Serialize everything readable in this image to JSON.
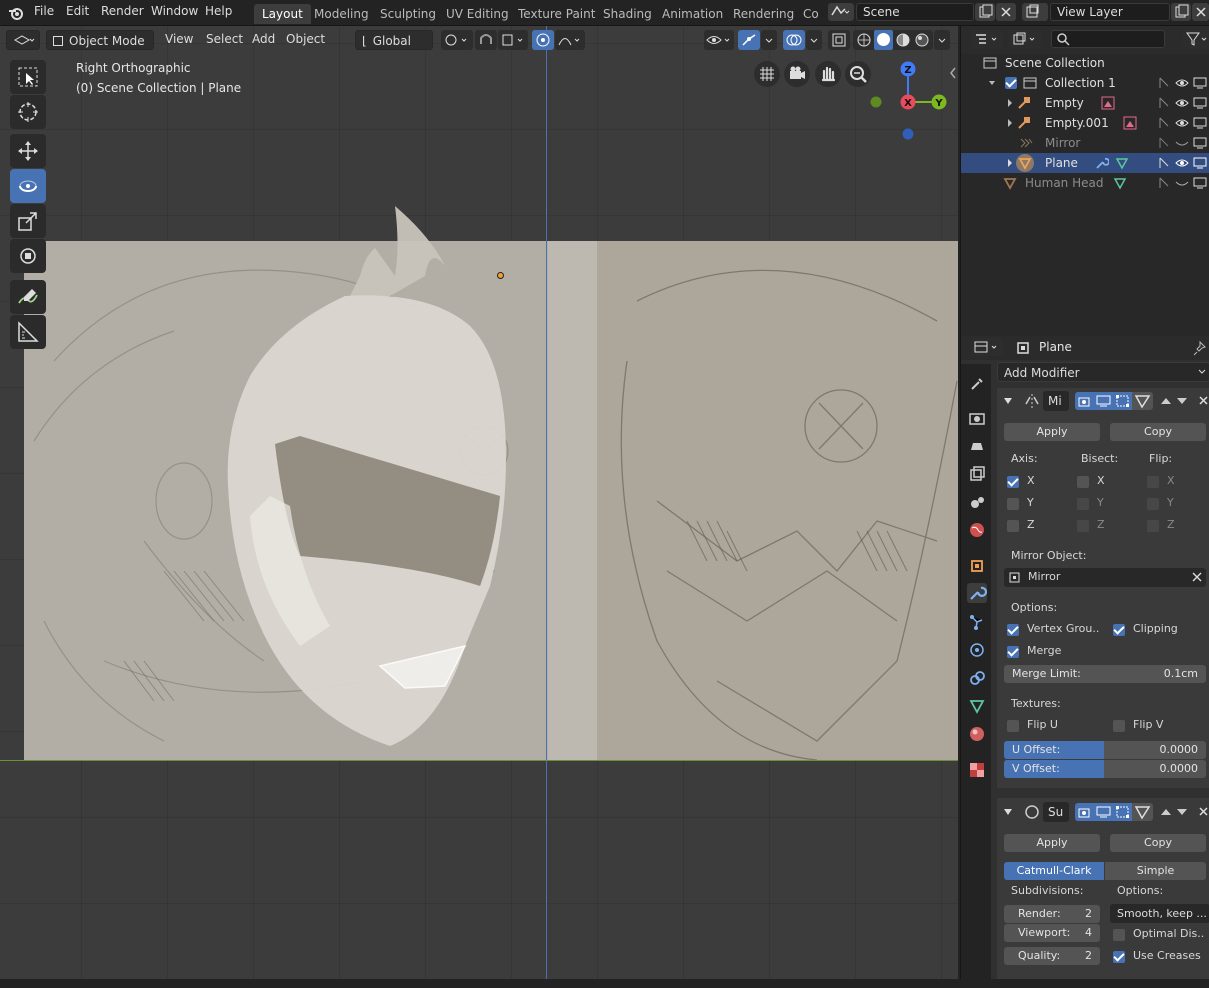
{
  "menu": {
    "items": [
      "File",
      "Edit",
      "Render",
      "Window",
      "Help"
    ]
  },
  "workspaces": {
    "tabs": [
      "Layout",
      "Modeling",
      "Sculpting",
      "UV Editing",
      "Texture Paint",
      "Shading",
      "Animation",
      "Rendering",
      "Co"
    ],
    "active": "Layout"
  },
  "scene": {
    "name": "Scene"
  },
  "view_layer": {
    "name": "View Layer"
  },
  "viewport": {
    "mode": "Object Mode",
    "menus": [
      "View",
      "Select",
      "Add",
      "Object"
    ],
    "transform_orientation": "Global",
    "view_name": "Right Orthographic",
    "collection_info": "(0) Scene Collection | Plane",
    "gizmo": {
      "z": "Z",
      "x": "X",
      "y": "Y"
    },
    "colors": {
      "x_axis": "#e94a5c",
      "y_axis": "#7cb820",
      "z_axis": "#3f7cf6",
      "accent": "#4772b3"
    }
  },
  "tools": [
    "select-box-icon",
    "cursor-icon",
    "move-icon",
    "rotate-icon",
    "scale-icon",
    "transform-icon",
    "annotate-icon",
    "measure-icon"
  ],
  "outliner": {
    "search_placeholder": "",
    "rows": [
      {
        "name": "Scene Collection",
        "type": "scene-collection-icon"
      },
      {
        "name": "Collection 1",
        "type": "collection-icon"
      },
      {
        "name": "Empty",
        "type": "empty-icon"
      },
      {
        "name": "Empty.001",
        "type": "empty-icon"
      },
      {
        "name": "Mirror",
        "type": "empty-icon"
      },
      {
        "name": "Plane",
        "type": "mesh-icon"
      },
      {
        "name": "Human Head",
        "type": "mesh-icon"
      }
    ]
  },
  "properties": {
    "object_name": "Plane",
    "add_modifier": "Add Modifier",
    "mirror": {
      "name": "Mi",
      "apply": "Apply",
      "copy": "Copy",
      "axis_label": "Axis:",
      "bisect_label": "Bisect:",
      "flip_label": "Flip:",
      "x": "X",
      "y": "Y",
      "z": "Z",
      "mirror_object_label": "Mirror Object:",
      "mirror_object": "Mirror",
      "options_label": "Options:",
      "vertex_groups": "Vertex Grou..",
      "clipping": "Clipping",
      "merge": "Merge",
      "merge_limit_label": "Merge Limit:",
      "merge_limit": "0.1cm",
      "textures_label": "Textures:",
      "flip_u": "Flip U",
      "flip_v": "Flip V",
      "u_offset_label": "U Offset:",
      "u_offset": "0.0000",
      "v_offset_label": "V Offset:",
      "v_offset": "0.0000"
    },
    "subsurf": {
      "name": "Su",
      "apply": "Apply",
      "copy": "Copy",
      "catmull": "Catmull-Clark",
      "simple": "Simple",
      "subdivisions_label": "Subdivisions:",
      "options_label": "Options:",
      "render_label": "Render:",
      "render": "2",
      "viewport_label": "Viewport:",
      "viewport": "4",
      "quality_label": "Quality:",
      "quality": "2",
      "smooth": "Smooth, keep ...",
      "optimal": "Optimal Dis..",
      "use_creases": "Use Creases"
    }
  }
}
